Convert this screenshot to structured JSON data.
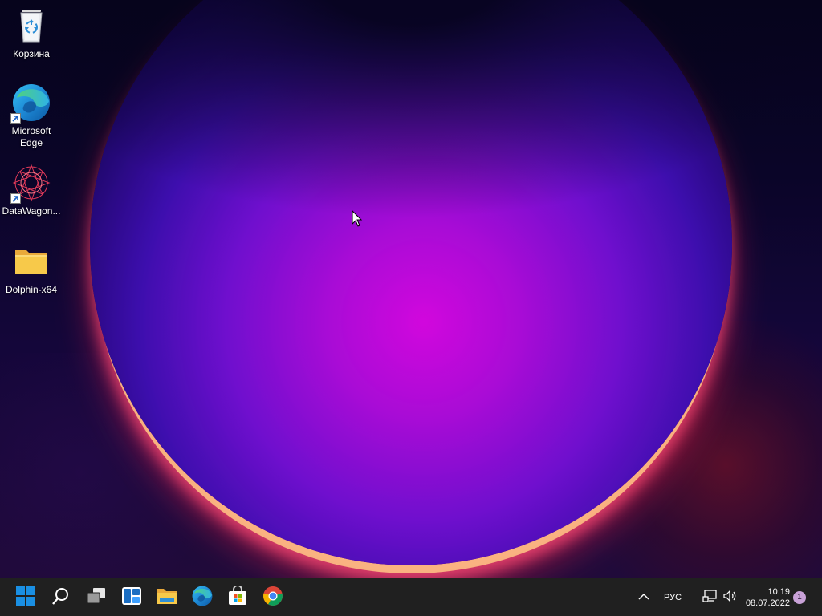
{
  "desktop": {
    "icons": [
      {
        "label": "Корзина",
        "icon": "recycle-bin-icon"
      },
      {
        "label": "Microsoft Edge",
        "icon": "edge-icon",
        "shortcut": true
      },
      {
        "label": "DataWagon...",
        "icon": "datawagon-icon",
        "shortcut": true
      },
      {
        "label": "Dolphin-x64",
        "icon": "folder-icon"
      }
    ]
  },
  "taskbar": {
    "apps": [
      {
        "name": "Start",
        "icon": "windows-start-icon"
      },
      {
        "name": "Search",
        "icon": "search-icon"
      },
      {
        "name": "Task View",
        "icon": "task-view-icon"
      },
      {
        "name": "Widgets",
        "icon": "widgets-icon"
      },
      {
        "name": "File Explorer",
        "icon": "file-explorer-icon"
      },
      {
        "name": "Microsoft Edge",
        "icon": "edge-icon"
      },
      {
        "name": "Microsoft Store",
        "icon": "store-icon"
      },
      {
        "name": "Google Chrome",
        "icon": "chrome-icon"
      }
    ],
    "tray": {
      "overflow_icon": "chevron-up-icon",
      "language": "РУС",
      "network_icon": "network-icon",
      "volume_icon": "speaker-icon",
      "time": "10:19",
      "date": "08.07.2022",
      "notification_count": "1"
    }
  },
  "colors": {
    "taskbar_bg": "#202020",
    "start_blue": "#1a8fe3",
    "folder_yellow": "#f7c94a",
    "badge_pink": "#c9a2d8"
  }
}
